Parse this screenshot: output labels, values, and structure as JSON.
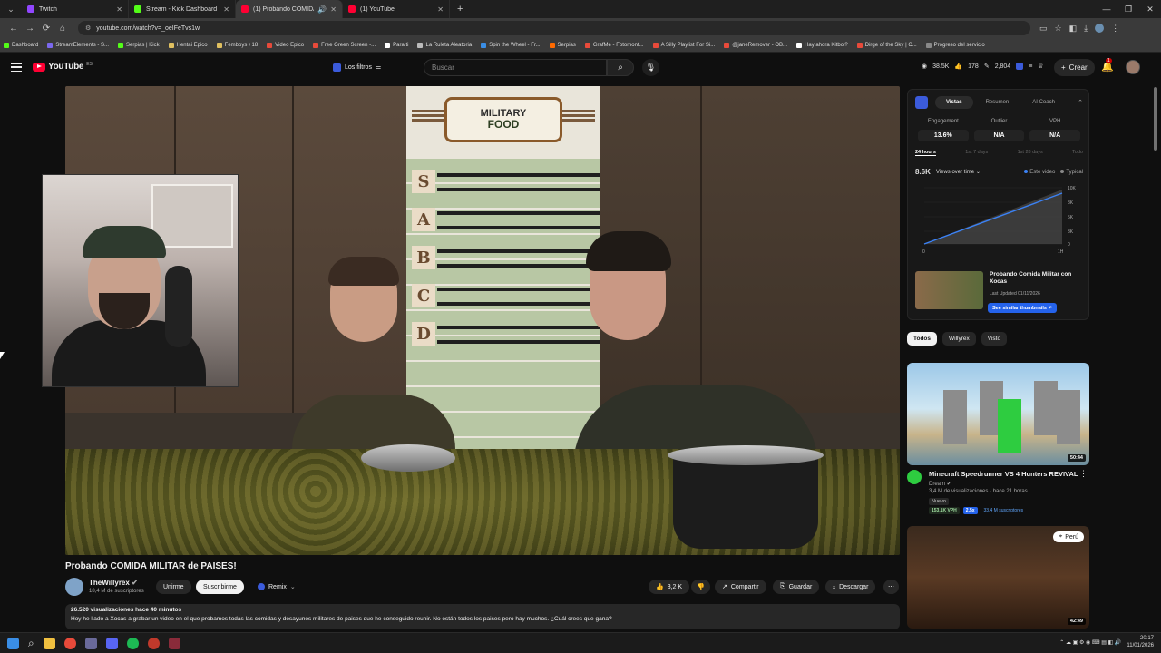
{
  "browser": {
    "tabs": [
      {
        "title": "Twitch",
        "color": "#9146ff",
        "active": false
      },
      {
        "title": "Stream - Kick Dashboard",
        "color": "#53fc18",
        "active": false
      },
      {
        "title": "(1) Probando COMIDA MIL",
        "color": "#ff0033",
        "active": true
      },
      {
        "title": "(1) YouTube",
        "color": "#ff0033",
        "active": false
      }
    ],
    "url": "youtube.com/watch?v=_oeIFeTvs1w",
    "bookmarks": [
      "Dashboard",
      "StreamElements - S...",
      "Serpias | Kick",
      "Hentai Epico",
      "Femboys +18",
      "Video Epico",
      "Free Green Screen -...",
      "Para ti",
      "La Ruleta Aleatoria",
      "Spin the Wheel - Fr...",
      "Serpias",
      "GrafMe - Fotomont...",
      "A Silly Playlist For Si...",
      "@janeRemover - OB...",
      "Hay ahora Kitboi?",
      "Dirge of the Sky | C...",
      "Progreso del servicio"
    ]
  },
  "header": {
    "logo": "YouTube",
    "country": "ES",
    "filters_label": "Los filtros",
    "search_placeholder": "Buscar",
    "stats": [
      "38.5K",
      "178",
      "2,804"
    ],
    "create_label": "Crear",
    "notif_count": "1"
  },
  "video": {
    "poster_line1": "MILITARY",
    "poster_line2": "FOOD",
    "tiers": [
      "S",
      "A",
      "B",
      "C",
      "D"
    ],
    "title": "Probando COMIDA MILITAR de PAISES!",
    "channel": "TheWillyrex",
    "subs": "18,4 M de suscriptores",
    "join_label": "Unirme",
    "subscribe_label": "Suscribirme",
    "remix_label": "Remix",
    "likes": "3,2 K",
    "share_label": "Compartir",
    "save_label": "Guardar",
    "download_label": "Descargar",
    "views_line": "26.520 visualizaciones  hace 40 minutos",
    "description": "Hoy he liado a Xocas a grabar un video en el que probamos todas las comidas y desayunos militares de paises que he conseguido reunir. No están todos los paises pero hay muchos. ¿Cuál crees que gana?"
  },
  "panel": {
    "tabs": [
      "Vistas",
      "Resumen",
      "AI Coach"
    ],
    "metrics": [
      {
        "label": "Engagement",
        "value": "13.6%"
      },
      {
        "label": "Outlier",
        "value": "N/A"
      },
      {
        "label": "VPH",
        "value": "N/A"
      }
    ],
    "ranges": [
      "24 hours",
      "1st 7 days",
      "1st 28 days",
      "Todo"
    ],
    "views_total": "8.6K",
    "views_mode": "Views over time",
    "legend": [
      "Este video",
      "Typical"
    ],
    "chart_y_ticks": [
      "10K",
      "8K",
      "5K",
      "3K",
      "0"
    ],
    "chart_x_ticks": [
      "0",
      "1H"
    ],
    "video_title": "Probando Comida Militar con Xocas",
    "updated": "Last Updated 01/11/2026",
    "similar_label": "See similar thumbnails ↗",
    "accent": "#3b82f6"
  },
  "chips": [
    "Todos",
    "Willyrex",
    "Visto"
  ],
  "recs": [
    {
      "title": "Minecraft Speedrunner VS 4 Hunters REVIVAL",
      "channel": "Dream",
      "views": "3,4 M de visualizaciones · hace 21 horas",
      "badge": "Nuevo",
      "vph": "153.1K VPH",
      "mult": "2.5x",
      "subs": "33.4 M suscriptores",
      "duration": "50:44"
    },
    {
      "location": "Perú",
      "duration": "42:49"
    }
  ],
  "taskbar": {
    "time": "20:17",
    "date": "11/01/2026"
  }
}
